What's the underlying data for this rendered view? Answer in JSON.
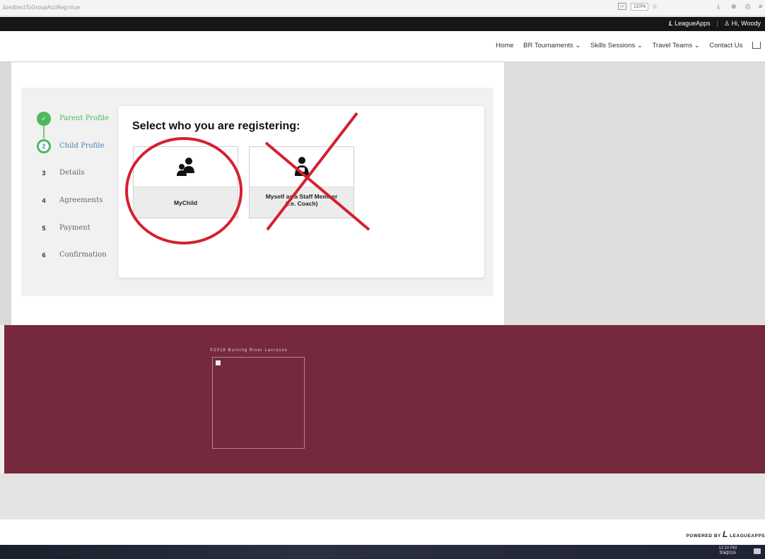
{
  "browser": {
    "url": "&redirectToGroupAccReg=true",
    "zoom": "110%"
  },
  "topnav": {
    "brand": "LeagueApps",
    "greeting": "Hi, Woody"
  },
  "menu": {
    "items": [
      "Home",
      "BR Tournaments",
      "Skills Sessions",
      "Travel Teams",
      "Contact Us"
    ]
  },
  "steps": [
    {
      "num": "✓",
      "label": "Parent Profile",
      "state": "done"
    },
    {
      "num": "2",
      "label": "Child Profile",
      "state": "active"
    },
    {
      "num": "3",
      "label": "Details",
      "state": "todo"
    },
    {
      "num": "4",
      "label": "Agreements",
      "state": "todo"
    },
    {
      "num": "5",
      "label": "Payment",
      "state": "todo"
    },
    {
      "num": "6",
      "label": "Confirmation",
      "state": "todo"
    }
  ],
  "card": {
    "heading": "Select who you are registering:",
    "options": [
      {
        "label_line1": "MyChild",
        "label_line2": "",
        "icon": "parent-child-icon"
      },
      {
        "label_line1": "Myself as a Staff Member",
        "label_line2": "(i.e. Coach)",
        "icon": "coach-icon"
      }
    ]
  },
  "footer": {
    "copyright": "©2018 Burning River Lacrosse",
    "powered": "POWERED BY",
    "powered_brand": "LEAGUEAPPS"
  },
  "taskbar": {
    "time": "12:10 PM",
    "date": "3/5/2026"
  },
  "colors": {
    "footer": "#76293c",
    "step_done": "#4cba5a",
    "annotation": "#d4202f"
  }
}
